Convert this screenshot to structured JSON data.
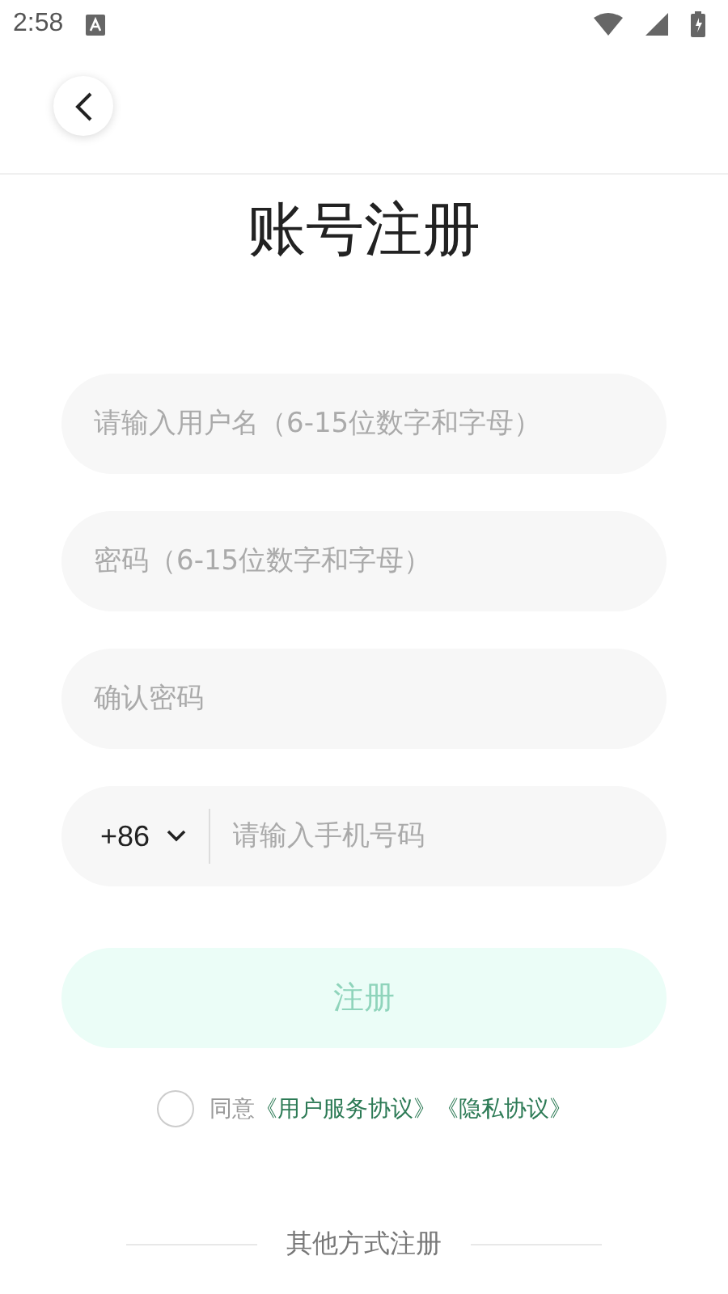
{
  "status_bar": {
    "time": "2:58"
  },
  "title": "账号注册",
  "fields": [
    {
      "kind": "text",
      "placeholder": "请输入用户名（6-15位数字和字母）"
    },
    {
      "kind": "text",
      "placeholder": "密码（6-15位数字和字母）"
    },
    {
      "kind": "text",
      "placeholder": "确认密码"
    },
    {
      "kind": "phone",
      "country_code": "+86",
      "placeholder": "请输入手机号码"
    }
  ],
  "register_button": {
    "label": "注册",
    "disabled": true
  },
  "agreement": {
    "checked": false,
    "prefix": "同意",
    "links": [
      "《用户服务协议》",
      "《隐私协议》"
    ]
  },
  "other_methods": "其他方式注册"
}
